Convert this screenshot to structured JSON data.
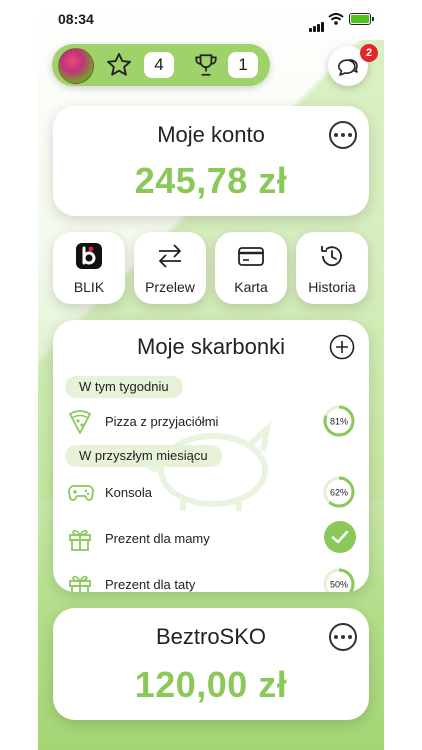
{
  "status_bar": {
    "time": "08:34"
  },
  "profile": {
    "stars": "4",
    "trophies": "1"
  },
  "messages": {
    "badge": "2"
  },
  "account": {
    "title": "Moje konto",
    "balance": "245,78 zł"
  },
  "actions": [
    {
      "label": "BLIK",
      "icon": "blik-icon"
    },
    {
      "label": "Przelew",
      "icon": "transfer-icon"
    },
    {
      "label": "Karta",
      "icon": "card-icon"
    },
    {
      "label": "Historia",
      "icon": "history-icon"
    }
  ],
  "goals": {
    "title": "Moje skarbonki",
    "sections": [
      {
        "label": "W tym tygodniu",
        "items": [
          {
            "name": "Pizza z przyjaciółmi",
            "icon": "pizza-icon",
            "progress": 81,
            "progress_label": "81%"
          }
        ]
      },
      {
        "label": "W przyszłym miesiącu",
        "items": [
          {
            "name": "Konsola",
            "icon": "gamepad-icon",
            "progress": 62,
            "progress_label": "62%"
          },
          {
            "name": "Prezent dla mamy",
            "icon": "gift-icon",
            "progress": 100,
            "completed": true
          },
          {
            "name": "Prezent dla taty",
            "icon": "gift-icon",
            "progress": 50,
            "progress_label": "50%"
          }
        ]
      }
    ]
  },
  "beztrosko": {
    "title": "BeztroSKO",
    "balance": "120,00 zł"
  },
  "colors": {
    "accent": "#8bc85a",
    "pill": "#9fd26a",
    "badge": "#e0282b"
  }
}
